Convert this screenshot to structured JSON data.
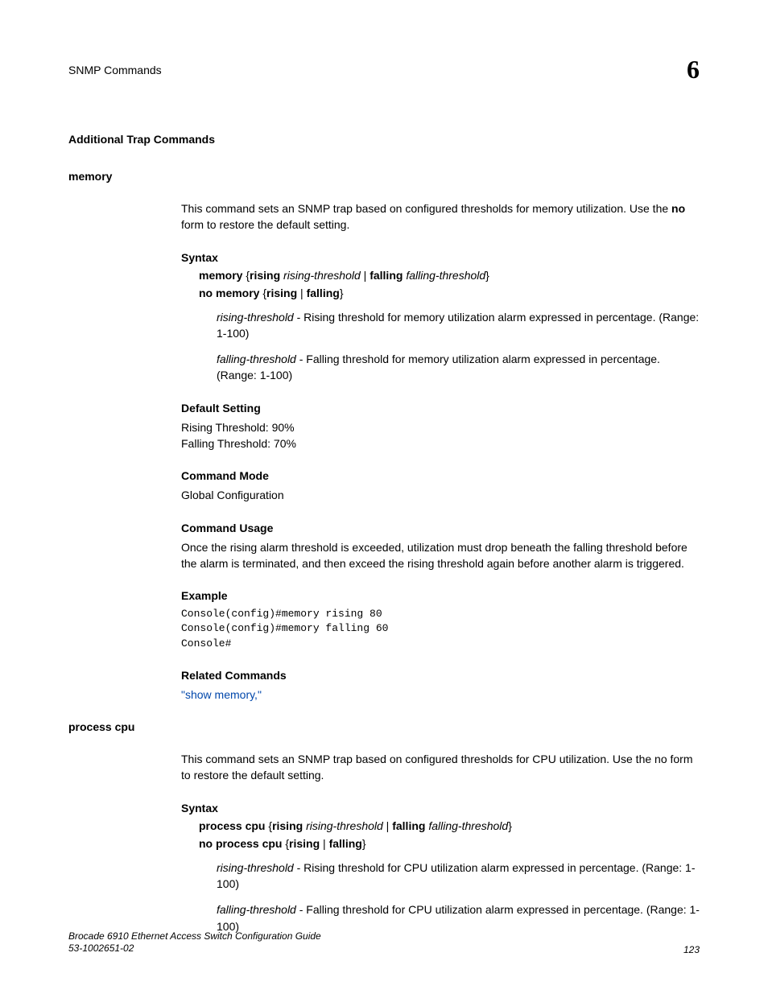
{
  "header": {
    "title": "SNMP Commands",
    "chapter": "6"
  },
  "section_subtitle": "Additional Trap Commands",
  "memory": {
    "name": "memory",
    "desc_pre": "This command sets an SNMP trap based on configured thresholds for memory utilization. Use the ",
    "desc_bold": "no",
    "desc_post": " form to restore the default setting.",
    "syntax_heading": "Syntax",
    "syntax_cmd": "memory",
    "syntax_brace_open": " {",
    "syntax_rising": "rising",
    "syntax_rising_arg": " rising-threshold",
    "syntax_pipe": " | ",
    "syntax_falling": "falling",
    "syntax_falling_arg": " falling-threshold",
    "syntax_brace_close": "}",
    "no_cmd": "no memory",
    "no_rest": " {",
    "no_rising": "rising",
    "no_pipe": " | ",
    "no_falling": "falling",
    "no_close": "}",
    "rising_param": "rising-threshold",
    "rising_desc": " - Rising threshold for memory utilization alarm expressed in percentage. (Range: 1-100)",
    "falling_param": "falling-threshold",
    "falling_desc": " - Falling threshold for memory utilization alarm expressed in percentage. (Range: 1-100)",
    "default_heading": "Default Setting",
    "default_rising": "Rising Threshold: 90%",
    "default_falling": "Falling Threshold: 70%",
    "mode_heading": "Command Mode",
    "mode_text": "Global Configuration",
    "usage_heading": "Command Usage",
    "usage_text": "Once the rising alarm threshold is exceeded, utilization must drop beneath the falling threshold before the alarm is terminated, and then exceed the rising threshold again before another alarm is triggered.",
    "example_heading": "Example",
    "example_code": "Console(config)#memory rising 80\nConsole(config)#memory falling 60\nConsole#",
    "related_heading": "Related Commands",
    "related_link": "\"show memory,\""
  },
  "cpu": {
    "name": "process cpu",
    "desc": "This command sets an SNMP trap based on configured thresholds for CPU utilization. Use the no form to restore the default setting.",
    "syntax_heading": "Syntax",
    "syntax_cmd": "process cpu",
    "syntax_brace_open": " {",
    "syntax_rising": "rising",
    "syntax_rising_arg": " rising-threshold",
    "syntax_pipe": " | ",
    "syntax_falling": "falling",
    "syntax_falling_arg": " falling-threshold",
    "syntax_brace_close": "}",
    "no_cmd": "no process cpu",
    "no_rest": " {",
    "no_rising": "rising",
    "no_pipe": " | ",
    "no_falling": "falling",
    "no_close": "}",
    "rising_param": "rising-threshold",
    "rising_desc": " - Rising threshold for CPU utilization alarm expressed in percentage. (Range: 1-100)",
    "falling_param": "falling-threshold",
    "falling_desc": " - Falling threshold for CPU utilization alarm expressed in percentage. (Range: 1-100)"
  },
  "footer": {
    "guide": "Brocade 6910 Ethernet Access Switch Configuration Guide",
    "partnum": "53-1002651-02",
    "page": "123"
  }
}
